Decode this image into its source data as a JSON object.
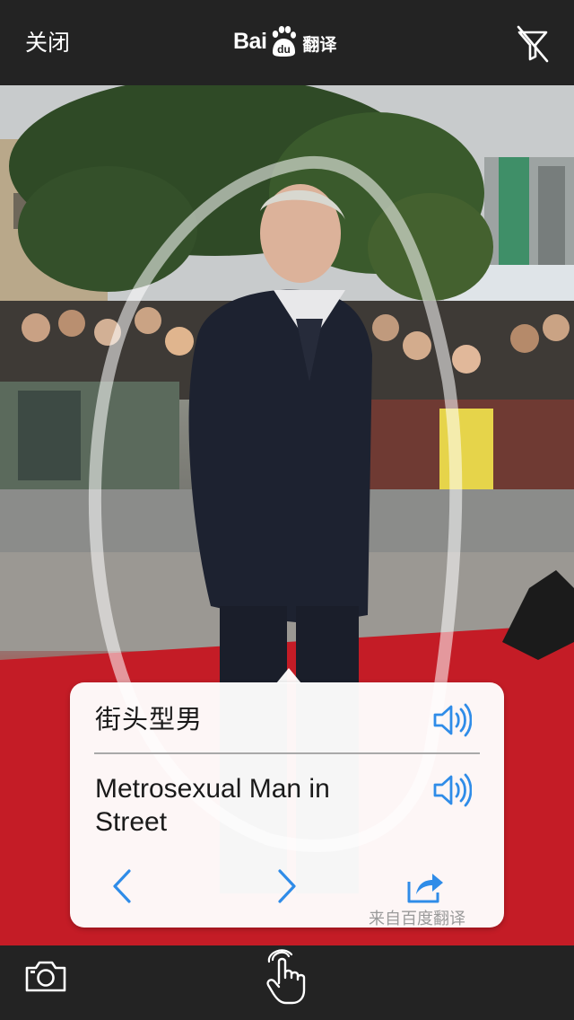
{
  "header": {
    "close_label": "关闭",
    "logo_text_left": "Bai",
    "logo_paw_text": "du",
    "logo_text_right": "翻译",
    "icons": {
      "filter_off": "no-filter-icon",
      "logo": "baidu-paw-icon"
    }
  },
  "result": {
    "source_text": "街头型男",
    "translation_text": "Metrosexual Man in Street",
    "attribution": "来自百度翻译",
    "icons": {
      "speaker": "speaker-icon",
      "previous": "chevron-left-icon",
      "next": "chevron-right-icon",
      "share": "share-icon"
    }
  },
  "bottom_bar": {
    "icons": {
      "camera": "camera-icon",
      "hand": "hand-pointer-icon"
    }
  },
  "colors": {
    "bar_background": "#232323",
    "accent_blue": "#2f8ce8",
    "card_background": "#ffffff",
    "carpet_red": "#c41c26"
  }
}
